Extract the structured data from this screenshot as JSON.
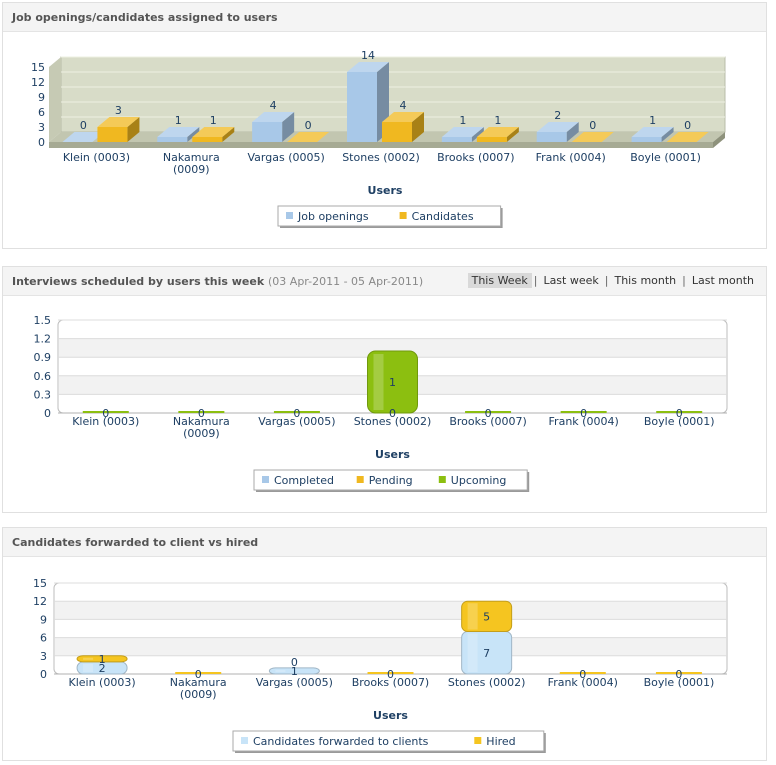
{
  "panels": [
    {
      "title": "Job openings/candidates assigned to users",
      "chart_data": {
        "type": "bar",
        "style": "3d-clustered",
        "categories": [
          "Klein (0003)",
          "Nakamura (0009)",
          "Vargas (0005)",
          "Stones (0002)",
          "Brooks (0007)",
          "Frank (0004)",
          "Boyle (0001)"
        ],
        "series": [
          {
            "name": "Job openings",
            "values": [
              0,
              1,
              4,
              14,
              1,
              2,
              1
            ],
            "color": "#a8c8e8"
          },
          {
            "name": "Candidates",
            "values": [
              3,
              1,
              0,
              4,
              1,
              0,
              0
            ],
            "color": "#f0b820"
          }
        ],
        "xlabel": "Users",
        "ylim": [
          0,
          15
        ],
        "yticks": [
          0,
          3,
          6,
          9,
          12,
          15
        ],
        "grid": true,
        "legend": "bottom"
      }
    },
    {
      "title": "Interviews scheduled by users this week",
      "subtitle": "(03 Apr-2011 - 05 Apr-2011)",
      "tabs": [
        "This Week",
        "Last week",
        "This month",
        "Last month"
      ],
      "active_tab": "This Week",
      "chart_data": {
        "type": "bar",
        "style": "stacked",
        "categories": [
          "Klein (0003)",
          "Nakamura (0009)",
          "Vargas (0005)",
          "Stones (0002)",
          "Brooks (0007)",
          "Frank (0004)",
          "Boyle (0001)"
        ],
        "series": [
          {
            "name": "Completed",
            "values": [
              0,
              0,
              0,
              0,
              0,
              0,
              0
            ],
            "color": "#a8c8e8"
          },
          {
            "name": "Pending",
            "values": [
              0,
              0,
              0,
              0,
              0,
              0,
              0
            ],
            "color": "#f0b820"
          },
          {
            "name": "Upcoming",
            "values": [
              0,
              0,
              0,
              1,
              0,
              0,
              0
            ],
            "color": "#8cbf10"
          }
        ],
        "xlabel": "Users",
        "ylim": [
          0,
          1.5
        ],
        "yticks": [
          "0",
          "0.3",
          "0.6",
          "0.9",
          "1.2",
          "1.5"
        ],
        "grid": true,
        "legend": "bottom"
      }
    },
    {
      "title": "Candidates forwarded to client vs hired",
      "chart_data": {
        "type": "bar",
        "style": "stacked",
        "categories": [
          "Klein (0003)",
          "Nakamura (0009)",
          "Vargas (0005)",
          "Brooks (0007)",
          "Stones (0002)",
          "Frank (0004)",
          "Boyle (0001)"
        ],
        "series": [
          {
            "name": "Candidates forwarded to clients",
            "values": [
              2,
              0,
              1,
              0,
              7,
              0,
              0
            ],
            "color": "#c8e4f8"
          },
          {
            "name": "Hired",
            "values": [
              1,
              0,
              0,
              0,
              5,
              0,
              0
            ],
            "color": "#f5c520"
          }
        ],
        "xlabel": "Users",
        "ylim": [
          0,
          15
        ],
        "yticks": [
          0,
          3,
          6,
          9,
          12,
          15
        ],
        "grid": true,
        "legend": "bottom"
      }
    }
  ]
}
